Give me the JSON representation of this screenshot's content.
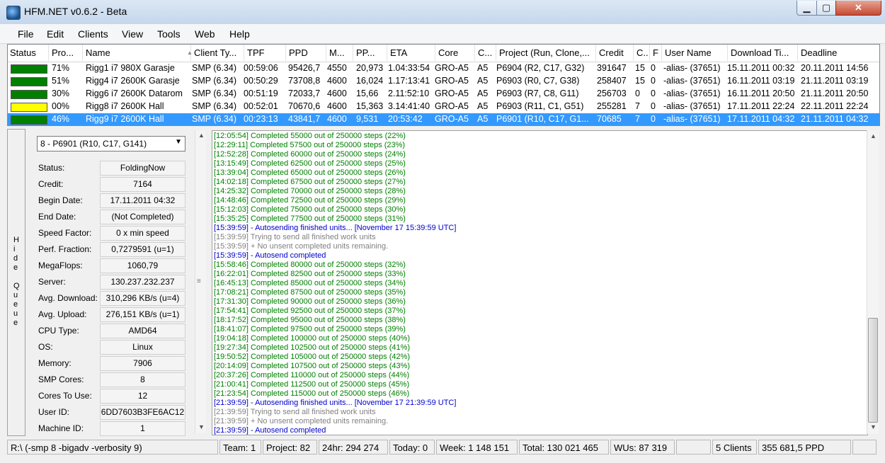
{
  "window": {
    "title": "HFM.NET v0.6.2 - Beta",
    "min_glyph": "▁",
    "max_glyph": "▢",
    "close_glyph": "✕"
  },
  "menu": [
    "File",
    "Edit",
    "Clients",
    "View",
    "Tools",
    "Web",
    "Help"
  ],
  "grid": {
    "headers": [
      "Status",
      "Pro...",
      "Name",
      "Client Ty...",
      "TPF",
      "PPD",
      "M...",
      "PP...",
      "ETA",
      "Core",
      "C...",
      "Project (Run, Clone,...",
      "Credit",
      "C...",
      "F",
      "User Name",
      "Download Ti...",
      "Deadline"
    ],
    "sort_glyph": "▲",
    "rows": [
      {
        "status_color": "#008000",
        "cells": [
          "71%",
          "Rigg1 i7 980X Garasje",
          "SMP (6.34)",
          "00:59:06",
          "95426,7",
          "4550",
          "20,973",
          "1.04:33:54",
          "GRO-A5",
          "A5",
          "P6904 (R2, C17, G32)",
          "391647",
          "15",
          "0",
          "-alias- (37651)",
          "15.11.2011 00:32",
          "20.11.2011 14:56"
        ]
      },
      {
        "status_color": "#008000",
        "cells": [
          "51%",
          "Rigg4 i7 2600K Garasje",
          "SMP (6.34)",
          "00:50:29",
          "73708,8",
          "4600",
          "16,024",
          "1.17:13:41",
          "GRO-A5",
          "A5",
          "P6903 (R0, C7, G38)",
          "258407",
          "15",
          "0",
          "-alias- (37651)",
          "16.11.2011 03:19",
          "21.11.2011 03:19"
        ]
      },
      {
        "status_color": "#008000",
        "cells": [
          "30%",
          "Rigg6 i7 2600K Datarom",
          "SMP (6.34)",
          "00:51:19",
          "72033,7",
          "4600",
          "15,66",
          "2.11:52:10",
          "GRO-A5",
          "A5",
          "P6903 (R7, C8, G11)",
          "256703",
          "0",
          "0",
          "-alias- (37651)",
          "16.11.2011 20:50",
          "21.11.2011 20:50"
        ]
      },
      {
        "status_color": "#ffff00",
        "cells": [
          "00%",
          "Rigg8 i7 2600K Hall",
          "SMP (6.34)",
          "00:52:01",
          "70670,6",
          "4600",
          "15,363",
          "3.14:41:40",
          "GRO-A5",
          "A5",
          "P6903 (R11, C1, G51)",
          "255281",
          "7",
          "0",
          "-alias- (37651)",
          "17.11.2011 22:24",
          "22.11.2011 22:24"
        ]
      },
      {
        "status_color": "#008000",
        "selected": true,
        "cells": [
          "46%",
          "Rigg9 i7 2600K Hall",
          "SMP (6.34)",
          "00:23:13",
          "43841,7",
          "4600",
          "9,531",
          "20:53:42",
          "GRO-A5",
          "A5",
          "P6901 (R10, C17, G1...",
          "70685",
          "7",
          "0",
          "-alias- (37651)",
          "17.11.2011 04:32",
          "21.11.2011 04:32"
        ]
      }
    ]
  },
  "hide_queue": {
    "letters": [
      "H",
      "i",
      "d",
      "e",
      "",
      "Q",
      "u",
      "e",
      "u",
      "e"
    ]
  },
  "queue": {
    "selected": "8 - P6901 (R10, C17, G141)",
    "dropdown_glyph": "▼",
    "fields": [
      {
        "label": "Status:",
        "value": "FoldingNow"
      },
      {
        "label": "Credit:",
        "value": "7164"
      },
      {
        "label": "Begin Date:",
        "value": "17.11.2011 04:32"
      },
      {
        "label": "End Date:",
        "value": "(Not Completed)"
      },
      {
        "label": "Speed Factor:",
        "value": "0 x min speed"
      },
      {
        "label": "Perf. Fraction:",
        "value": "0,7279591 (u=1)"
      },
      {
        "label": "MegaFlops:",
        "value": "1060,79"
      },
      {
        "label": "Server:",
        "value": "130.237.232.237"
      },
      {
        "label": "Avg. Download:",
        "value": "310,296 KB/s (u=4)"
      },
      {
        "label": "Avg. Upload:",
        "value": "276,151 KB/s (u=1)"
      },
      {
        "label": "CPU Type:",
        "value": "AMD64"
      },
      {
        "label": "OS:",
        "value": "Linux"
      },
      {
        "label": "Memory:",
        "value": "7906"
      },
      {
        "label": "SMP Cores:",
        "value": "8"
      },
      {
        "label": "Cores To Use:",
        "value": "12"
      },
      {
        "label": "User ID:",
        "value": "6DD7603B3FE6AC12"
      },
      {
        "label": "Machine ID:",
        "value": "1"
      }
    ]
  },
  "scroll_glyphs": {
    "up": "▲",
    "down": "▼",
    "grip": "≡"
  },
  "log": [
    {
      "t": "[12:05:54] Completed 55000 out of 250000 steps  (22%)",
      "c": "lg"
    },
    {
      "t": "[12:29:11] Completed 57500 out of 250000 steps  (23%)",
      "c": "lg"
    },
    {
      "t": "[12:52:28] Completed 60000 out of 250000 steps  (24%)",
      "c": "lg"
    },
    {
      "t": "[13:15:49] Completed 62500 out of 250000 steps  (25%)",
      "c": "lg"
    },
    {
      "t": "[13:39:04] Completed 65000 out of 250000 steps  (26%)",
      "c": "lg"
    },
    {
      "t": "[14:02:18] Completed 67500 out of 250000 steps  (27%)",
      "c": "lg"
    },
    {
      "t": "[14:25:32] Completed 70000 out of 250000 steps  (28%)",
      "c": "lg"
    },
    {
      "t": "[14:48:46] Completed 72500 out of 250000 steps  (29%)",
      "c": "lg"
    },
    {
      "t": "[15:12:03] Completed 75000 out of 250000 steps  (30%)",
      "c": "lg"
    },
    {
      "t": "[15:35:25] Completed 77500 out of 250000 steps  (31%)",
      "c": "lg"
    },
    {
      "t": "[15:39:59] - Autosending finished units... [November 17 15:39:59 UTC]",
      "c": "lb"
    },
    {
      "t": "[15:39:59] Trying to send all finished work units",
      "c": "lgr"
    },
    {
      "t": "[15:39:59] + No unsent completed units remaining.",
      "c": "lgr"
    },
    {
      "t": "[15:39:59] - Autosend completed",
      "c": "lb"
    },
    {
      "t": "[15:58:46] Completed 80000 out of 250000 steps  (32%)",
      "c": "lg"
    },
    {
      "t": "[16:22:01] Completed 82500 out of 250000 steps  (33%)",
      "c": "lg"
    },
    {
      "t": "[16:45:13] Completed 85000 out of 250000 steps  (34%)",
      "c": "lg"
    },
    {
      "t": "[17:08:21] Completed 87500 out of 250000 steps  (35%)",
      "c": "lg"
    },
    {
      "t": "[17:31:30] Completed 90000 out of 250000 steps  (36%)",
      "c": "lg"
    },
    {
      "t": "[17:54:41] Completed 92500 out of 250000 steps  (37%)",
      "c": "lg"
    },
    {
      "t": "[18:17:52] Completed 95000 out of 250000 steps  (38%)",
      "c": "lg"
    },
    {
      "t": "[18:41:07] Completed 97500 out of 250000 steps  (39%)",
      "c": "lg"
    },
    {
      "t": "[19:04:18] Completed 100000 out of 250000 steps  (40%)",
      "c": "lg"
    },
    {
      "t": "[19:27:34] Completed 102500 out of 250000 steps  (41%)",
      "c": "lg"
    },
    {
      "t": "[19:50:52] Completed 105000 out of 250000 steps  (42%)",
      "c": "lg"
    },
    {
      "t": "[20:14:09] Completed 107500 out of 250000 steps  (43%)",
      "c": "lg"
    },
    {
      "t": "[20:37:26] Completed 110000 out of 250000 steps  (44%)",
      "c": "lg"
    },
    {
      "t": "[21:00:41] Completed 112500 out of 250000 steps  (45%)",
      "c": "lg"
    },
    {
      "t": "[21:23:54] Completed 115000 out of 250000 steps  (46%)",
      "c": "lg"
    },
    {
      "t": "[21:39:59] - Autosending finished units... [November 17 21:39:59 UTC]",
      "c": "lb"
    },
    {
      "t": "[21:39:59] Trying to send all finished work units",
      "c": "lgr"
    },
    {
      "t": "[21:39:59] + No unsent completed units remaining.",
      "c": "lgr"
    },
    {
      "t": "[21:39:59] - Autosend completed",
      "c": "lb"
    }
  ],
  "statusbar": [
    "R:\\ (-smp 8 -bigadv -verbosity 9)",
    "Team: 1",
    "Project: 82",
    "24hr: 294 274",
    "Today: 0",
    "Week: 1 148 151",
    "Total: 130 021 465",
    "WUs: 87 319",
    "",
    "5 Clients",
    "355 681,5 PPD",
    ""
  ]
}
